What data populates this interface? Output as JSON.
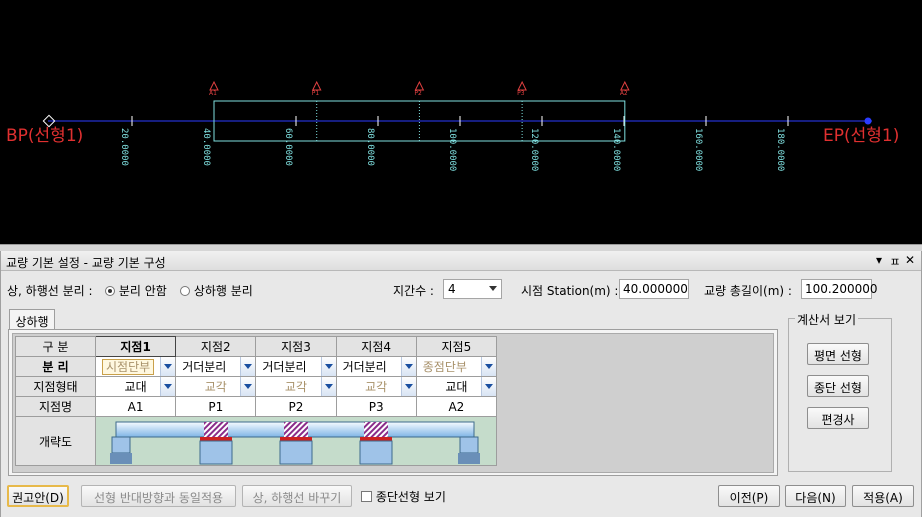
{
  "cad": {
    "bp_label": "BP(선형1)",
    "ep_label": "EP(선형1)",
    "stations": [
      "20.0000",
      "40.0000",
      "60.0000",
      "80.0000",
      "100.0000",
      "120.0000",
      "140.0000",
      "160.0000",
      "180.0000"
    ],
    "supports": [
      "A1",
      "P1",
      "P2",
      "P3",
      "A2"
    ],
    "colors": {
      "background": "#000000",
      "alignment": "#2b3cff",
      "bridge": "#7fe0e0",
      "label": "#e03030",
      "tick": "#ffffff",
      "support": "#e04040"
    }
  },
  "panel": {
    "title": "교량 기본 설정 - 교량 기본 구성",
    "controls": [
      "▾",
      "ㅍ",
      "✕"
    ],
    "separation_label": "상, 하행선 분리 :",
    "separation_options": [
      {
        "label": "분리 안함",
        "selected": true
      },
      {
        "label": "상하행 분리",
        "selected": false
      }
    ],
    "span_count_label": "지간수 :",
    "span_count_value": "4",
    "start_station_label": "시점 Station(m) :",
    "start_station_value": "40.000000",
    "total_length_label": "교량 총길이(m) :",
    "total_length_value": "100.200000",
    "tab_label": "상하행",
    "grid": {
      "corner": "구 분",
      "columns": [
        "지점1",
        "지점2",
        "지점3",
        "지점4",
        "지점5"
      ],
      "rows": [
        {
          "header": "분 리",
          "values": [
            "시점단부",
            "거더분리",
            "거더분리",
            "거더분리",
            "종점단부"
          ],
          "dim": [
            true,
            false,
            false,
            false,
            true
          ]
        },
        {
          "header": "지점형태",
          "values": [
            "교대",
            "교각",
            "교각",
            "교각",
            "교대"
          ],
          "dim": [
            false,
            true,
            true,
            true,
            false
          ]
        },
        {
          "header": "지점명",
          "values": [
            "A1",
            "P1",
            "P2",
            "P3",
            "A2"
          ]
        }
      ],
      "diagram_header": "개략도"
    },
    "report_group": {
      "title": "계산서 보기",
      "buttons": [
        "평면 선형",
        "종단 선형",
        "편경사"
      ]
    },
    "bottom": {
      "recommend": "권고안(D)",
      "apply_reverse": "선형 반대방향과 동일적용",
      "swap_lines": "상, 하행선 바꾸기",
      "profile_check": "종단선형 보기",
      "prev": "이전(P)",
      "next": "다음(N)",
      "apply": "적용(A)"
    }
  }
}
